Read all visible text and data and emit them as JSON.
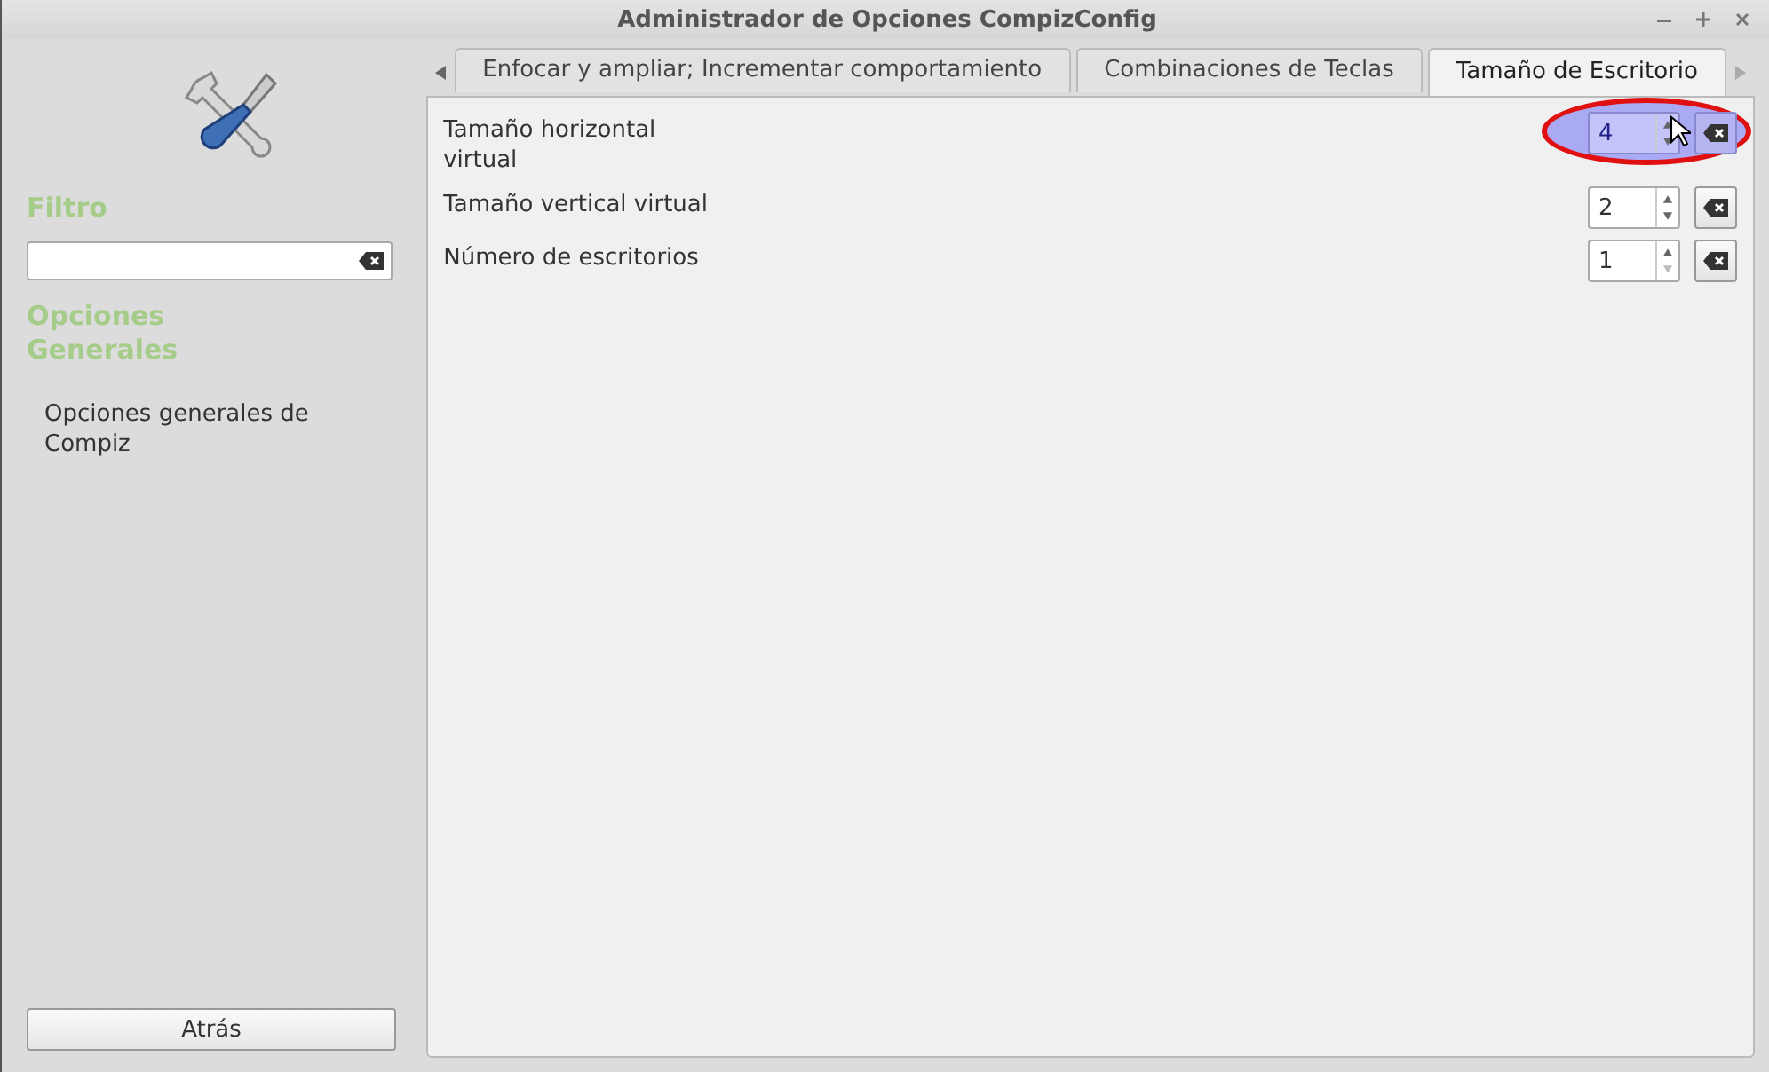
{
  "window": {
    "title": "Administrador de Opciones CompizConfig"
  },
  "sidebar": {
    "filter_heading": "Filtro",
    "section_heading": "Opciones Generales",
    "items": [
      {
        "label": "Opciones generales de Compiz",
        "selected": false
      }
    ],
    "back_button": "Atrás"
  },
  "tabs": [
    {
      "label": "Enfocar y ampliar; Incrementar comportamiento",
      "selected": false
    },
    {
      "label": "Combinaciones de Teclas",
      "selected": false
    },
    {
      "label": "Tamaño de Escritorio",
      "selected": true
    }
  ],
  "options": [
    {
      "label": "Tamaño horizontal virtual",
      "value": "4",
      "highlighted": true,
      "decrement_disabled": false
    },
    {
      "label": "Tamaño vertical virtual",
      "value": "2",
      "highlighted": false,
      "decrement_disabled": false
    },
    {
      "label": "Número de escritorios",
      "value": "1",
      "highlighted": false,
      "decrement_disabled": true
    }
  ]
}
